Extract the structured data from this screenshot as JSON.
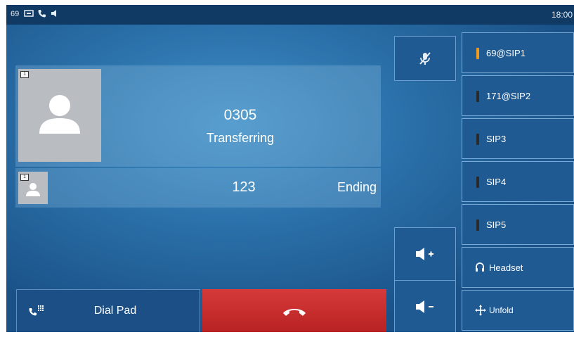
{
  "status_bar": {
    "account": "69",
    "time": "18:00"
  },
  "call": {
    "primary": {
      "badge": "1",
      "number": "0305",
      "status": "Transferring"
    },
    "secondary": {
      "badge": "1",
      "number": "123",
      "status": "Ending"
    }
  },
  "softkeys": {
    "dial_pad": "Dial Pad"
  },
  "line_keys": [
    {
      "label": "69@SIP1",
      "indicator_color": "#f29a1e"
    },
    {
      "label": "171@SIP2",
      "indicator_color": "#2a2a2a"
    },
    {
      "label": "SIP3",
      "indicator_color": "#2a2a2a"
    },
    {
      "label": "SIP4",
      "indicator_color": "#2a2a2a"
    },
    {
      "label": "SIP5",
      "indicator_color": "#2a2a2a"
    },
    {
      "label": "Headset",
      "icon": "headset-icon"
    },
    {
      "label": "Unfold",
      "icon": "move-arrows-icon"
    }
  ],
  "icons": {
    "status_bar": [
      "voicemail-icon",
      "phone-icon",
      "speaker-icon"
    ],
    "mute": "mute-mic-icon",
    "volume_up": "volume-up-icon",
    "volume_down": "volume-down-icon",
    "dial_pad": "dialpad-icon",
    "end_call": "hang-up-icon"
  },
  "colors": {
    "status_bar_bg": "#103a63",
    "end_call_red": "#c92e2e",
    "active_line_indicator": "#f29a1e"
  }
}
